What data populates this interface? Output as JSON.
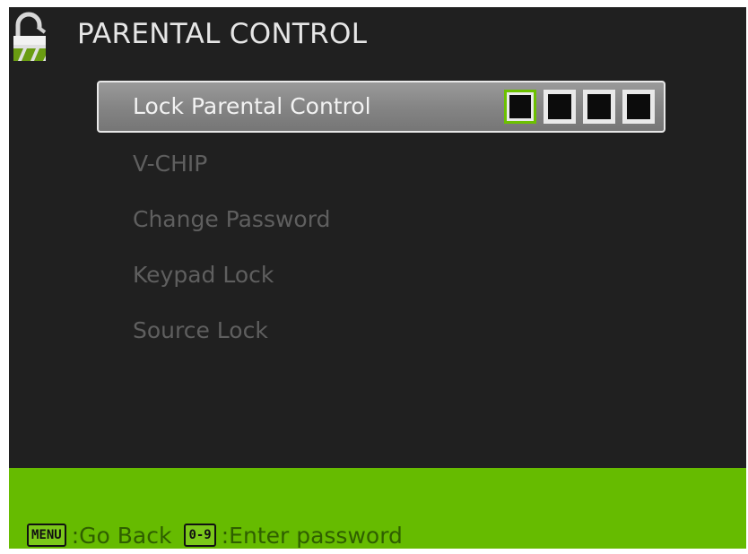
{
  "header": {
    "title": "PARENTAL CONTROL",
    "icon": "lock-icon"
  },
  "menu": {
    "items": [
      {
        "label": "Lock Parental Control",
        "selected": true
      },
      {
        "label": "V-CHIP",
        "selected": false
      },
      {
        "label": "Change Password",
        "selected": false
      },
      {
        "label": "Keypad Lock",
        "selected": false
      },
      {
        "label": "Source Lock",
        "selected": false
      }
    ],
    "pin_digits": 4,
    "pin_active_index": 0
  },
  "footer": {
    "keys": [
      {
        "key": "MENU",
        "action": ":Go Back"
      },
      {
        "key": "0-9",
        "action": ":Enter password"
      }
    ]
  },
  "colors": {
    "background": "#202020",
    "accent_green": "#66bb00",
    "selected_item": "#858585",
    "disabled_text": "#5f5f5f"
  }
}
